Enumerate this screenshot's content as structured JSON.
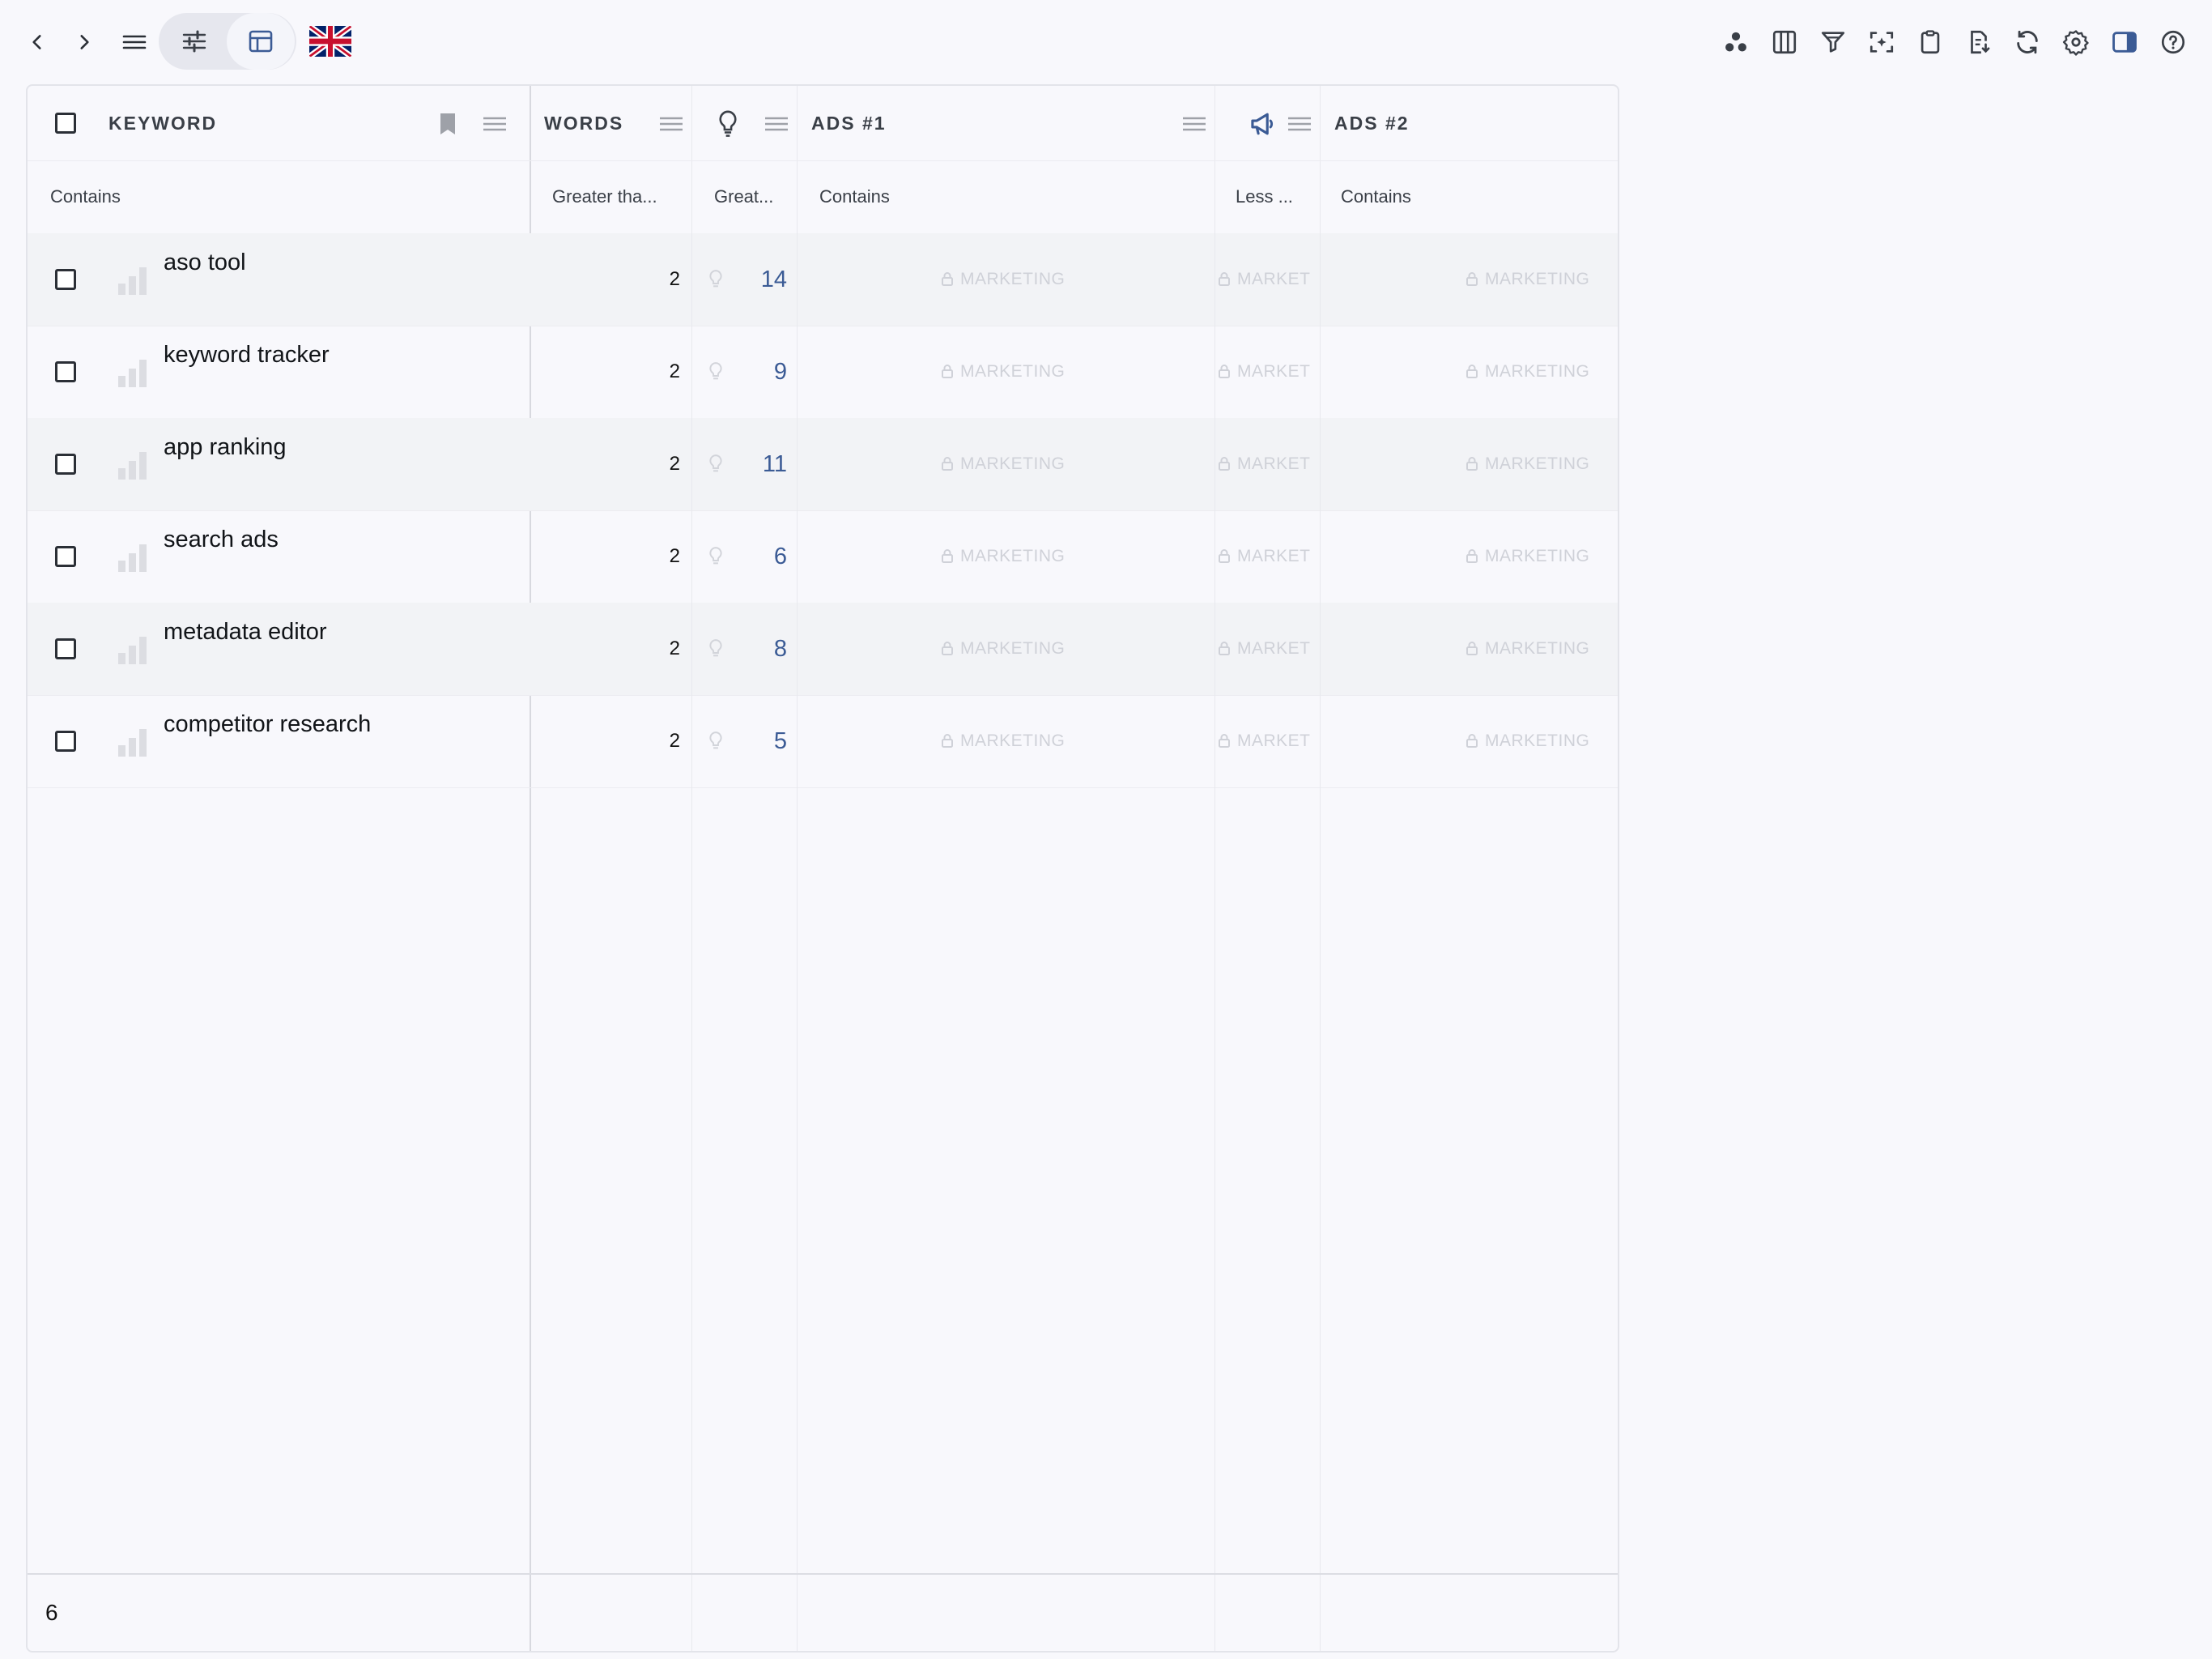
{
  "toolbar": {
    "back": "back-icon",
    "forward": "forward-icon",
    "menu": "menu-icon",
    "filters_toggle": "sliders-icon",
    "table_toggle": "table-icon",
    "country_flag": "uk-flag",
    "right_icons": [
      "clusters-icon",
      "columns-icon",
      "filter-icon",
      "focus-icon",
      "clipboard-icon",
      "export-icon",
      "refresh-icon",
      "settings-icon",
      "sidebar-icon",
      "help-icon"
    ]
  },
  "columns": {
    "keyword": "KEYWORD",
    "words": "WORDS",
    "ads1": "ADS #1",
    "ads2": "ADS #2"
  },
  "filters": {
    "keyword": "Contains",
    "words": "Greater tha...",
    "kei": "Great...",
    "ads1": "Contains",
    "ads_count": "Less ...",
    "ads2": "Contains"
  },
  "locked_label": "MARKETING",
  "locked_label_short": "MARKET",
  "rows": [
    {
      "keyword": "aso tool",
      "words": "2",
      "kei": "14"
    },
    {
      "keyword": "keyword tracker",
      "words": "2",
      "kei": "9"
    },
    {
      "keyword": "app ranking",
      "words": "2",
      "kei": "11"
    },
    {
      "keyword": "search ads",
      "words": "2",
      "kei": "6"
    },
    {
      "keyword": "metadata editor",
      "words": "2",
      "kei": "8"
    },
    {
      "keyword": "competitor research",
      "words": "2",
      "kei": "5"
    }
  ],
  "footer": {
    "count": "6"
  },
  "colors": {
    "accent": "#3b5b95",
    "muted": "#cfd1d8"
  }
}
